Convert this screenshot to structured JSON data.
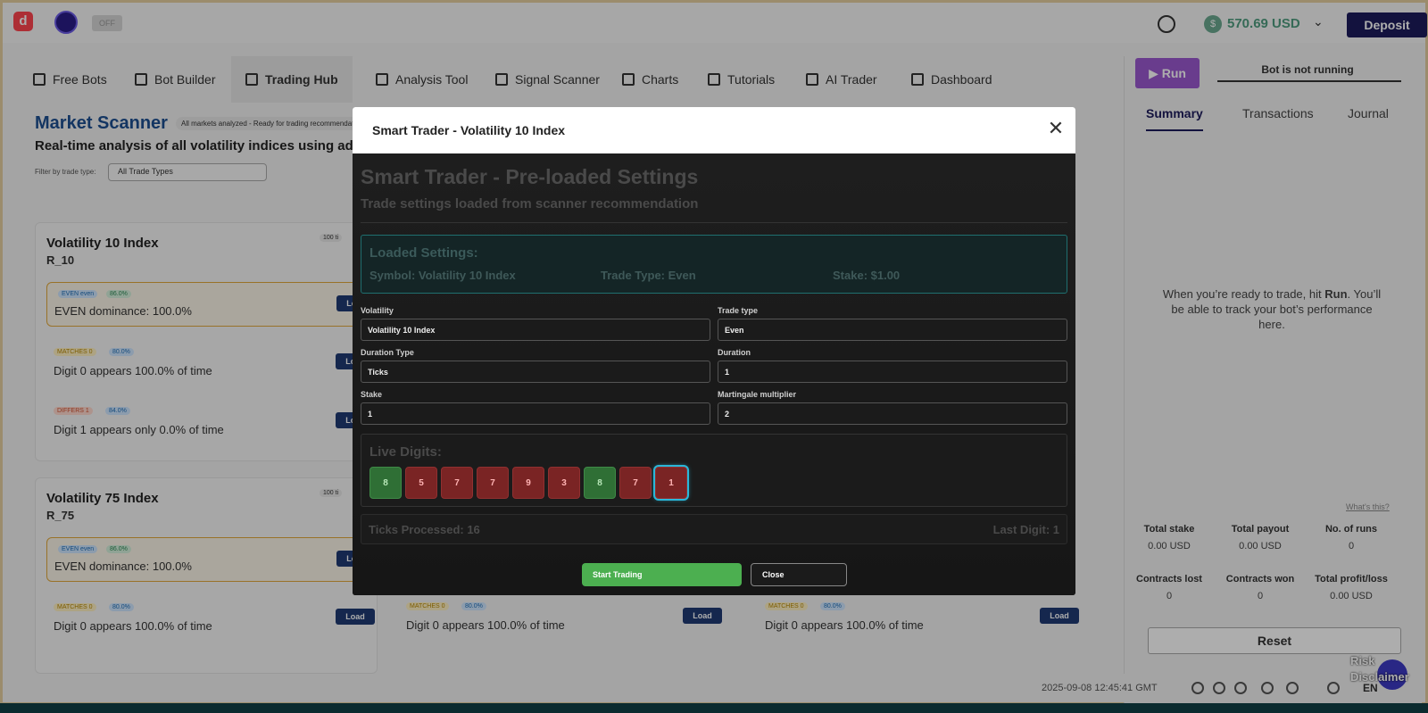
{
  "topbar": {
    "logo_letter": "d",
    "toggle": "OFF",
    "balance": "570.69 USD",
    "deposit": "Deposit"
  },
  "nav": {
    "items": [
      {
        "label": "Free Bots",
        "icon": "grid-icon"
      },
      {
        "label": "Bot Builder",
        "icon": "builder-icon"
      },
      {
        "label": "Trading Hub",
        "icon": "swap-icon"
      },
      {
        "label": "Analysis Tool",
        "icon": "sliders-icon"
      },
      {
        "label": "Signal Scanner",
        "icon": "list-icon"
      },
      {
        "label": "Charts",
        "icon": "chart-icon"
      },
      {
        "label": "Tutorials",
        "icon": "play-icon"
      },
      {
        "label": "AI Trader",
        "icon": "layers-icon"
      },
      {
        "label": "Dashboard",
        "icon": "dashboard-icon"
      }
    ],
    "active": "Trading Hub"
  },
  "run_panel": {
    "run": "Run",
    "status": "Bot is not running",
    "tabs": [
      "Summary",
      "Transactions",
      "Journal"
    ],
    "empty_line1": "When you’re ready to trade, hit",
    "empty_run": "Run",
    "empty_line2": "You’ll be able to track your bot’s performance here.",
    "whats_this": "What's this?",
    "stats": [
      {
        "label": "Total stake",
        "value": "0.00 USD"
      },
      {
        "label": "Total payout",
        "value": "0.00 USD"
      },
      {
        "label": "No. of runs",
        "value": "0"
      },
      {
        "label": "Contracts lost",
        "value": "0"
      },
      {
        "label": "Contracts won",
        "value": "0"
      },
      {
        "label": "Total profit/loss",
        "value": "0.00 USD"
      }
    ],
    "reset": "Reset"
  },
  "scanner": {
    "title": "Market Scanner",
    "badge": "All markets analyzed - Ready for trading recommendation",
    "subtitle": "Real-time analysis of all volatility indices using adv",
    "filter_label": "Filter by trade type:",
    "filter_value": "All Trade Types",
    "cards": [
      {
        "title": "Volatility 10 Index",
        "symbol": "R_10",
        "badge": "100 ti",
        "recs": [
          {
            "chip1": "EVEN even",
            "chip2": "86.0%",
            "text": "EVEN dominance: 100.0%",
            "load": "Load"
          },
          {
            "chip1": "MATCHES 0",
            "chip2": "80.0%",
            "text": "Digit 0 appears 100.0% of time",
            "load": "Load"
          },
          {
            "chip1": "DIFFERS 1",
            "chip2": "84.0%",
            "text": "Digit 1 appears only 0.0% of time",
            "load": "Load"
          }
        ]
      },
      {
        "title": "Volatility 75 Index",
        "symbol": "R_75",
        "badge": "100 ti",
        "recs": [
          {
            "chip1": "EVEN even",
            "chip2": "86.0%",
            "text": "EVEN dominance: 100.0%",
            "load": "Load"
          },
          {
            "chip1": "MATCHES 0",
            "chip2": "80.0%",
            "text": "Digit 0 appears 100.0% of time",
            "load": "Load"
          }
        ]
      }
    ],
    "bottom_recs": [
      {
        "chip1": "MATCHES 0",
        "chip2": "80.0%",
        "text": "Digit 0 appears 100.0% of time",
        "load": "Load"
      },
      {
        "chip1": "MATCHES 0",
        "chip2": "80.0%",
        "text": "Digit 0 appears 100.0% of time",
        "load": "Load"
      }
    ]
  },
  "footer": {
    "datetime": "2025-09-08 12:45:41 GMT",
    "lang": "EN",
    "risk": "Risk Disclaimer"
  },
  "modal": {
    "title": "Smart Trader - Volatility 10 Index",
    "heading": "Smart Trader - Pre-loaded Settings",
    "subheading": "Trade settings loaded from scanner recommendation",
    "loaded_title": "Loaded Settings:",
    "loaded_symbol": "Symbol: Volatility 10 Index",
    "loaded_type": "Trade Type: Even",
    "loaded_stake": "Stake: $1.00",
    "fields": {
      "volatility": {
        "label": "Volatility",
        "value": "Volatility 10 Index"
      },
      "trade_type": {
        "label": "Trade type",
        "value": "Even"
      },
      "duration_type": {
        "label": "Duration Type",
        "value": "Ticks"
      },
      "duration": {
        "label": "Duration",
        "value": "1"
      },
      "stake": {
        "label": "Stake",
        "value": "1"
      },
      "martingale": {
        "label": "Martingale multiplier",
        "value": "2"
      }
    },
    "live_title": "Live Digits:",
    "digits": [
      8,
      5,
      7,
      7,
      9,
      3,
      8,
      7,
      1
    ],
    "ticks_processed": "Ticks Processed: 16",
    "last_digit": "Last Digit: 1",
    "start": "Start Trading",
    "close": "Close"
  }
}
